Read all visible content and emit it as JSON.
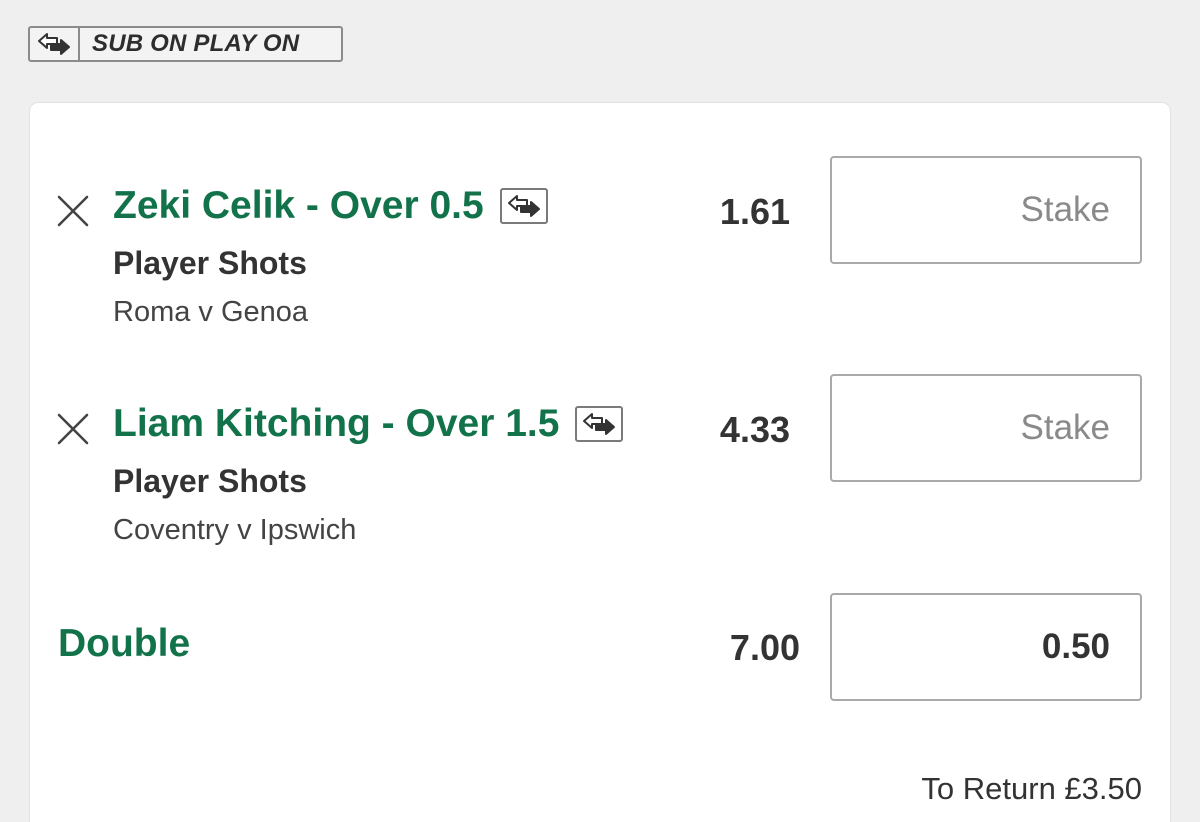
{
  "banner": {
    "icon": "sub-on-play-on-icon",
    "label": "SUB ON PLAY ON"
  },
  "selections": [
    {
      "title": "Zeki Celik - Over 0.5",
      "icon": "sub-on-play-on-icon",
      "market": "Player Shots",
      "event": "Roma v Genoa",
      "odds": "1.61",
      "stake_placeholder": "Stake"
    },
    {
      "title": "Liam Kitching - Over 1.5",
      "icon": "sub-on-play-on-icon",
      "market": "Player Shots",
      "event": "Coventry v Ipswich",
      "odds": "4.33",
      "stake_placeholder": "Stake"
    }
  ],
  "multiple": {
    "label": "Double",
    "odds": "7.00",
    "stake": "0.50"
  },
  "summary": {
    "to_return": "To Return £3.50"
  },
  "colors": {
    "accent_green": "#12734b",
    "background": "#efefef",
    "text_dark": "#333333"
  }
}
